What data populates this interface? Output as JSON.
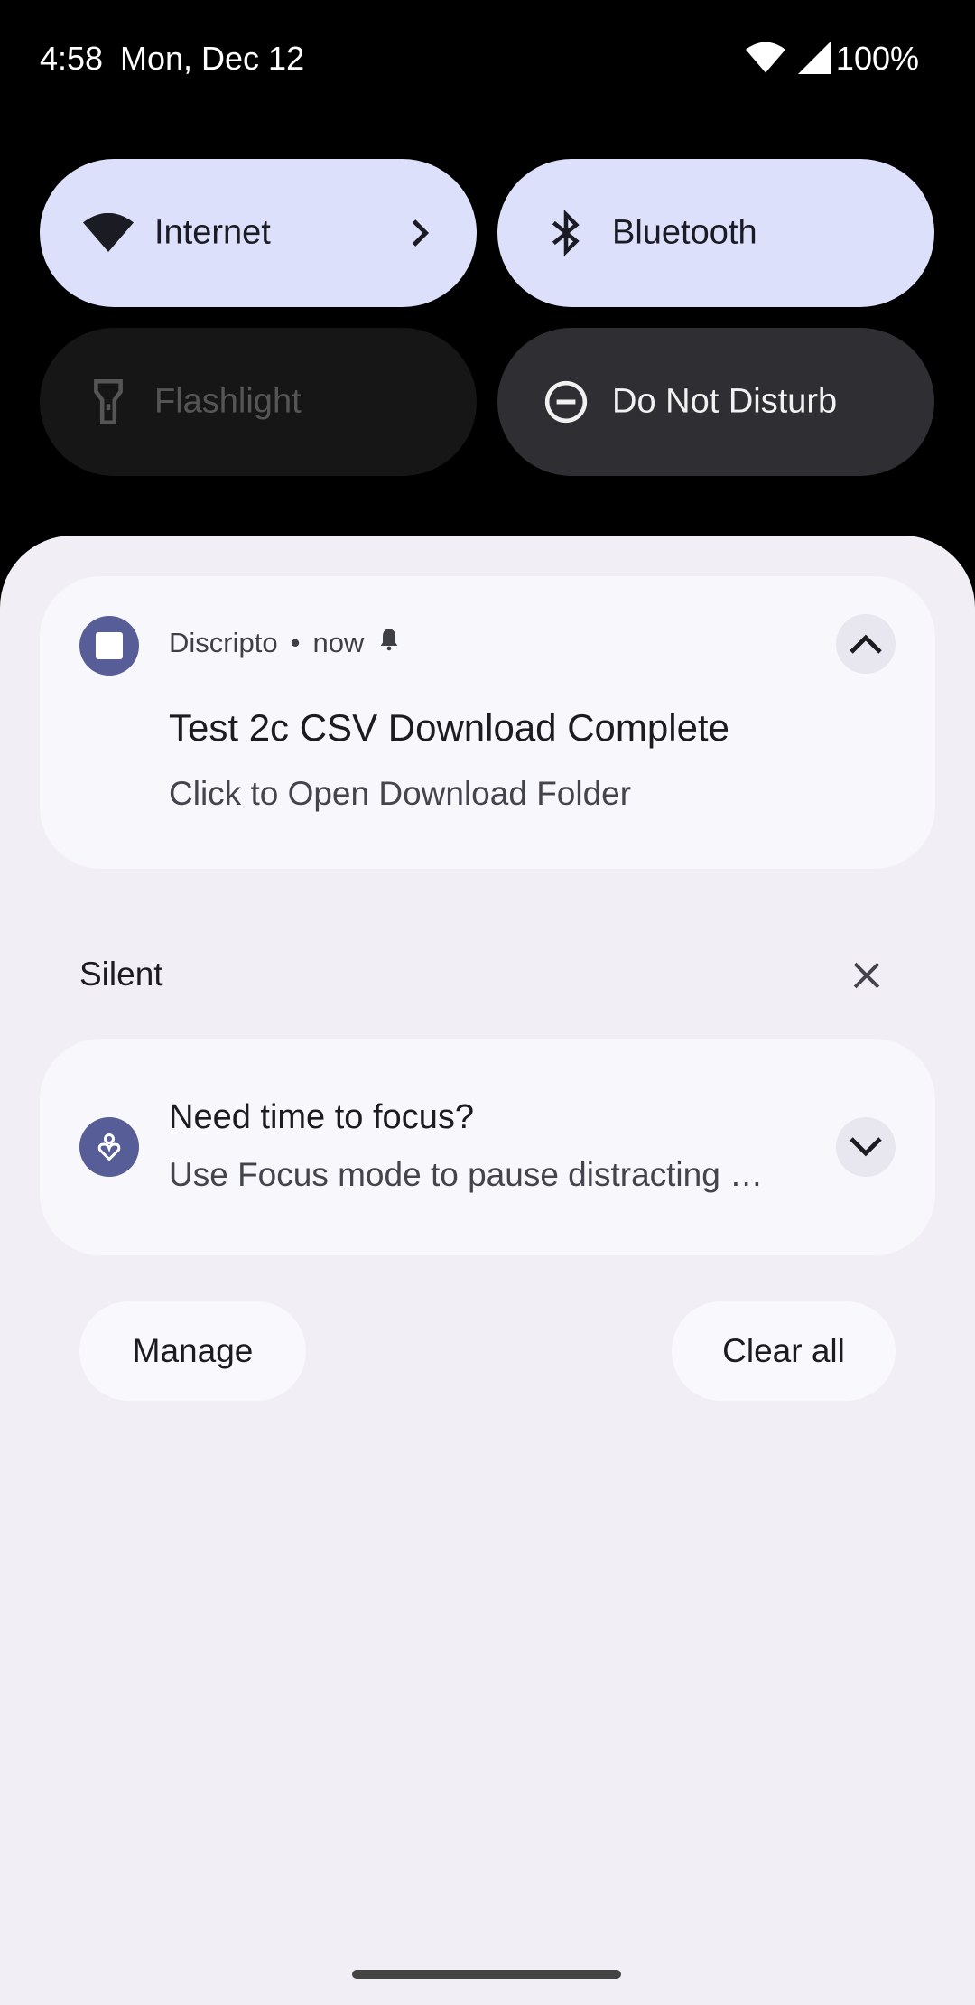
{
  "status_bar": {
    "time": "4:58",
    "date": "Mon, Dec 12",
    "battery": "100%",
    "icons": [
      "wifi-icon",
      "cell-signal-icon"
    ]
  },
  "quick_settings": {
    "tiles": [
      {
        "label": "Internet",
        "icon": "wifi-icon",
        "state": "on"
      },
      {
        "label": "Bluetooth",
        "icon": "bluetooth-icon",
        "state": "on"
      },
      {
        "label": "Flashlight",
        "icon": "flashlight-icon",
        "state": "unavailable"
      },
      {
        "label": "Do Not Disturb",
        "icon": "dnd-icon",
        "state": "off"
      }
    ]
  },
  "notifications": {
    "download": {
      "app_name": "Discripto",
      "time": "now",
      "title": "Test 2c CSV Download Complete",
      "body": "Click to Open Download Folder"
    },
    "silent_section": {
      "label": "Silent"
    },
    "focus": {
      "title": "Need time to focus?",
      "body": "Use Focus mode to pause distracting …"
    }
  },
  "actions": {
    "manage": "Manage",
    "clear_all": "Clear all"
  },
  "colors": {
    "tile_active": "#dde0fb",
    "tile_inactive": "#2f2f33",
    "shade_bg": "#f1eff5",
    "app_icon": "#575d97"
  }
}
